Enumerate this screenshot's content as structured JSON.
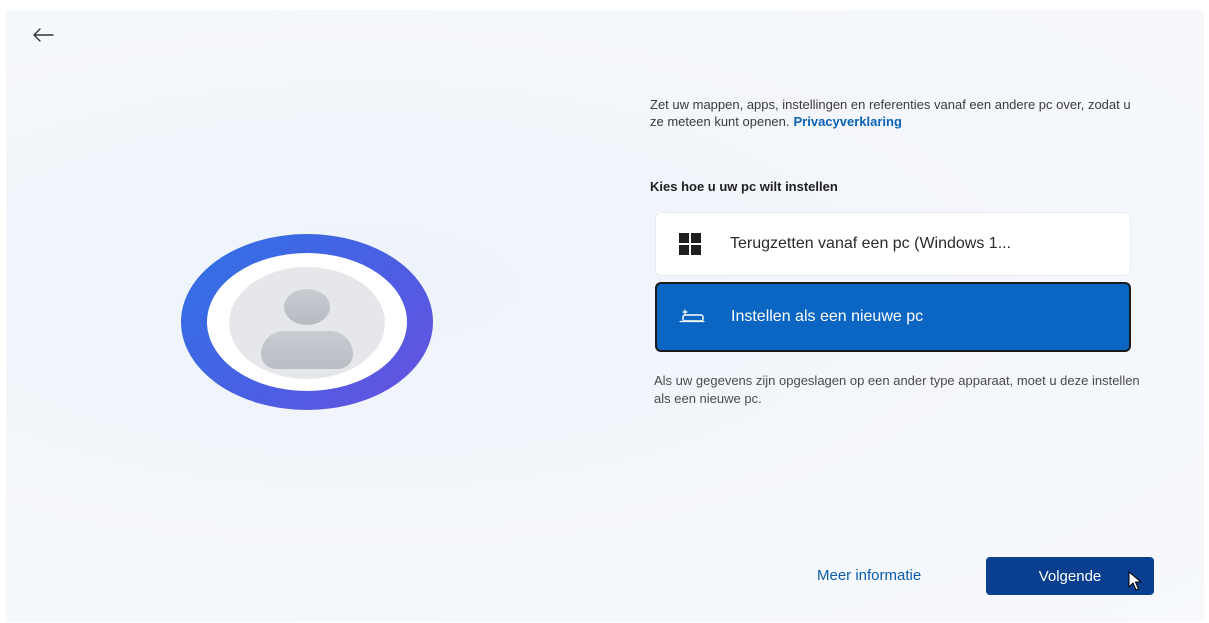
{
  "navigation": {
    "back_icon": "arrow-left-icon"
  },
  "content": {
    "intro_text": "Zet uw mappen, apps, instellingen en referenties vanaf een andere pc over, zodat u ze meteen kunt openen.",
    "privacy_link": "Privacyverklaring",
    "section_title": "Kies hoe u uw pc wilt instellen",
    "options": [
      {
        "label": "Terugzetten vanaf een pc (Windows 1...",
        "icon": "windows-logo-icon",
        "selected": false
      },
      {
        "label": "Instellen als een nieuwe pc",
        "icon": "new-pc-icon",
        "selected": true
      }
    ],
    "note": "Als uw gegevens zijn opgeslagen op een ander type apparaat, moet u deze instellen als een nieuwe pc."
  },
  "footer": {
    "more_info_label": "Meer informatie",
    "next_label": "Volgende"
  },
  "colors": {
    "accent": "#0a66c2",
    "primary_button": "#0a3f8f",
    "link": "#0b62b8",
    "avatar_gradient_start": "#2f72e6",
    "avatar_gradient_end": "#6a4fe0"
  }
}
